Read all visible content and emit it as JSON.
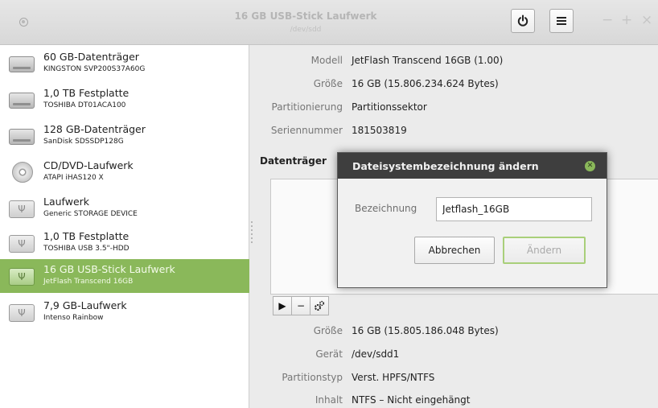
{
  "titlebar": {
    "title": "16 GB USB-Stick Laufwerk",
    "subtitle": "/dev/sdd",
    "power_icon": "power-icon",
    "menu_icon": "hamburger-menu-icon",
    "minimize": "−",
    "maximize": "+",
    "close": "×"
  },
  "sidebar": {
    "items": [
      {
        "name": "60 GB-Datenträger",
        "sub": "KINGSTON SVP200S37A60G",
        "icon": "hdd-icon"
      },
      {
        "name": "1,0 TB Festplatte",
        "sub": "TOSHIBA DT01ACA100",
        "icon": "hdd-icon"
      },
      {
        "name": "128 GB-Datenträger",
        "sub": "SanDisk SDSSDP128G",
        "icon": "hdd-icon"
      },
      {
        "name": "CD/DVD-Laufwerk",
        "sub": "ATAPI iHAS120 X",
        "icon": "optical-disc-icon"
      },
      {
        "name": "Laufwerk",
        "sub": "Generic STORAGE DEVICE",
        "icon": "usb-drive-icon"
      },
      {
        "name": "1,0 TB Festplatte",
        "sub": "TOSHIBA USB 3.5\"-HDD",
        "icon": "usb-drive-icon"
      },
      {
        "name": "16 GB USB-Stick Laufwerk",
        "sub": "JetFlash Transcend 16GB",
        "icon": "usb-drive-icon",
        "selected": true
      },
      {
        "name": "7,9 GB-Laufwerk",
        "sub": "Intenso Rainbow",
        "icon": "usb-drive-icon"
      }
    ]
  },
  "drive": {
    "model_label": "Modell",
    "model": "JetFlash Transcend 16GB (1.00)",
    "size_label": "Größe",
    "size": "16 GB (15.806.234.624 Bytes)",
    "partitioning_label": "Partitionierung",
    "partitioning": "Partitionssektor",
    "serial_label": "Seriennummer",
    "serial": "181503819"
  },
  "volumes": {
    "title": "Datenträger",
    "toolbar": {
      "play": "▶",
      "minus": "−",
      "settings_icon": "gears-icon"
    }
  },
  "partition": {
    "size_label": "Größe",
    "size": "16 GB (15.805.186.048 Bytes)",
    "device_label": "Gerät",
    "device": "/dev/sdd1",
    "type_label": "Partitionstyp",
    "type": "Verst. HPFS/NTFS",
    "content_label": "Inhalt",
    "content": "NTFS – Nicht eingehängt"
  },
  "dialog": {
    "title": "Dateisystembezeichnung ändern",
    "label": "Bezeichnung",
    "value": "Jetflash_16GB",
    "cancel": "Abbrechen",
    "apply": "Ändern",
    "close_icon": "close-circle-icon"
  },
  "colors": {
    "accent": "#8ab85a",
    "dialog_header": "#3e3e3e"
  }
}
